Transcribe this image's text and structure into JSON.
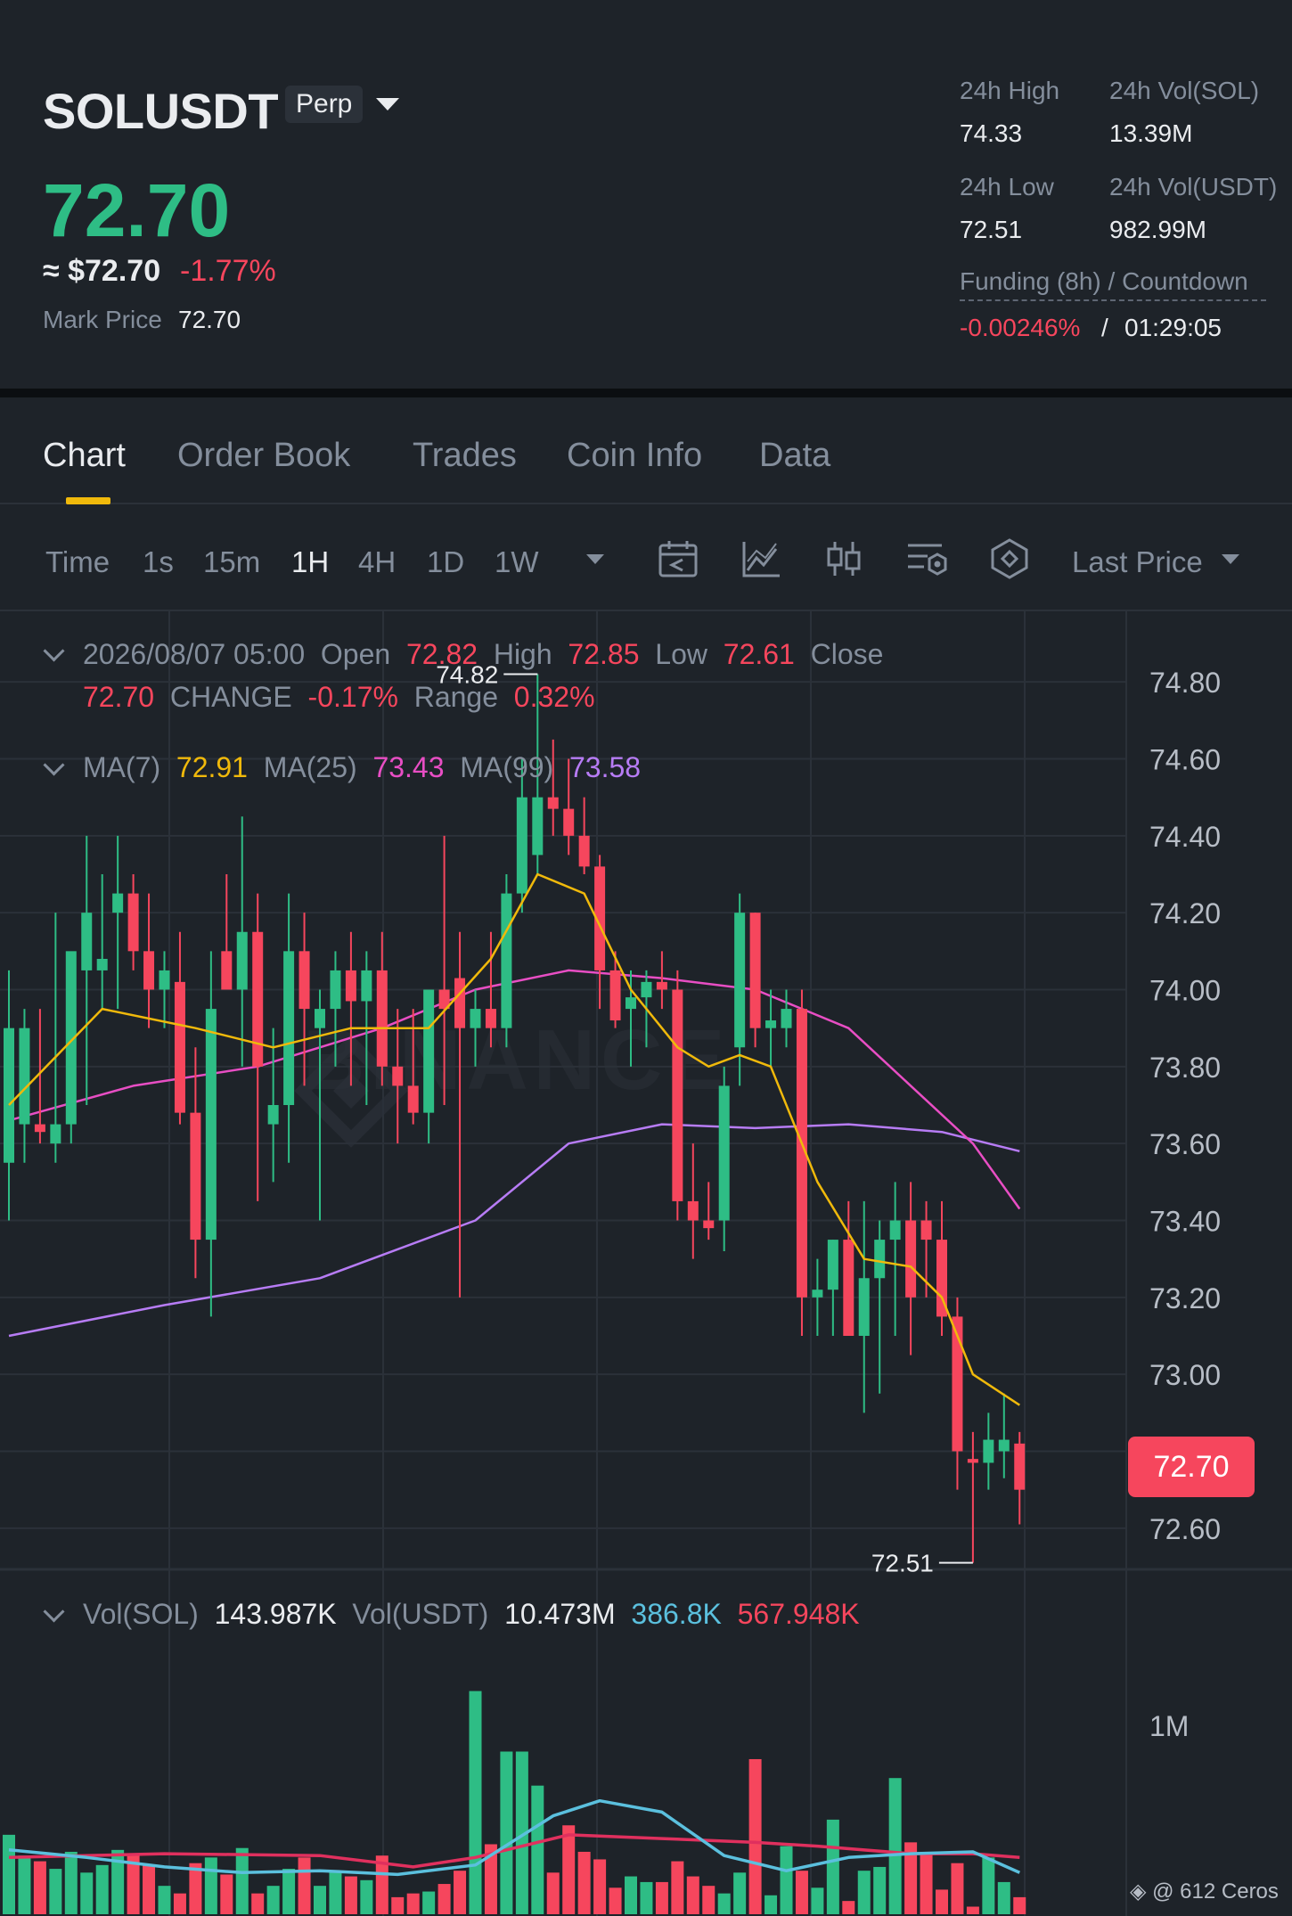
{
  "header": {
    "symbol": "SOLUSDT",
    "contract_type": "Perp",
    "last_price": "72.70",
    "usd_price": "≈ $72.70",
    "change_pct": "-1.77%",
    "mark_price_label": "Mark Price",
    "mark_price": "72.70",
    "stats": {
      "high_label": "24h High",
      "high": "74.33",
      "vol_sol_label": "24h Vol(SOL)",
      "vol_sol": "13.39M",
      "low_label": "24h Low",
      "low": "72.51",
      "vol_usdt_label": "24h Vol(USDT)",
      "vol_usdt": "982.99M"
    },
    "funding_label": "Funding (8h) / Countdown",
    "funding_rate": "-0.00246%",
    "funding_sep": "/",
    "countdown": "01:29:05"
  },
  "tabs": [
    {
      "label": "Chart",
      "active": true
    },
    {
      "label": "Order Book",
      "active": false
    },
    {
      "label": "Trades",
      "active": false
    },
    {
      "label": "Coin Info",
      "active": false
    },
    {
      "label": "Data",
      "active": false
    }
  ],
  "toolbar": {
    "timeframes": [
      {
        "label": "Time",
        "active": false
      },
      {
        "label": "1s",
        "active": false
      },
      {
        "label": "15m",
        "active": false
      },
      {
        "label": "1H",
        "active": true
      },
      {
        "label": "4H",
        "active": false
      },
      {
        "label": "1D",
        "active": false
      },
      {
        "label": "1W",
        "active": false
      }
    ],
    "icons": [
      "calendar-icon",
      "indicator-icon",
      "candle-type-icon",
      "chart-settings-icon",
      "depth-icon"
    ],
    "price_type": "Last Price"
  },
  "ohlc": {
    "datetime": "2026/08/07 05:00",
    "open_label": "Open",
    "open": "72.82",
    "high_label": "High",
    "high": "72.85",
    "low_label": "Low",
    "low": "72.61",
    "close_label": "Close",
    "close": "72.70",
    "change_label": "CHANGE",
    "change": "-0.17%",
    "range_label": "Range",
    "range": "0.32%"
  },
  "ma": {
    "ma7_label": "MA(7)",
    "ma7": "72.91",
    "ma25_label": "MA(25)",
    "ma25": "73.43",
    "ma99_label": "MA(99)",
    "ma99": "73.58"
  },
  "volume": {
    "vol_sol_label": "Vol(SOL)",
    "vol_sol": "143.987K",
    "vol_usdt_label": "Vol(USDT)",
    "vol_usdt": "10.473M",
    "ma5": "386.8K",
    "ma10": "567.948K"
  },
  "price_tag": "72.70",
  "watermark": "BINANCE",
  "footer": "@ 612 Ceros",
  "colors": {
    "up": "#2ebd85",
    "down": "#f6465d",
    "ma7": "#f0b90b",
    "ma25": "#e84ec4",
    "ma99": "#b77cf5",
    "vol_ma5": "#5bc0de",
    "vol_ma10": "#e0305e",
    "accent": "#f0b90b"
  },
  "chart_data": {
    "type": "candlestick",
    "interval": "1H",
    "ylim": [
      72.5,
      74.9
    ],
    "price_ticks": [
      74.8,
      74.6,
      74.4,
      74.2,
      74.0,
      73.8,
      73.6,
      73.4,
      73.2,
      73.0,
      72.8,
      72.6
    ],
    "max_marker": "74.82",
    "min_marker": "72.51",
    "candles": [
      {
        "o": 73.55,
        "h": 74.05,
        "l": 73.4,
        "c": 73.9
      },
      {
        "o": 73.65,
        "h": 73.95,
        "l": 73.55,
        "c": 73.9
      },
      {
        "o": 73.65,
        "h": 73.95,
        "l": 73.6,
        "c": 73.63
      },
      {
        "o": 73.6,
        "h": 74.2,
        "l": 73.55,
        "c": 73.65
      },
      {
        "o": 73.65,
        "h": 74.05,
        "l": 73.6,
        "c": 74.1
      },
      {
        "o": 74.05,
        "h": 74.4,
        "l": 73.7,
        "c": 74.2
      },
      {
        "o": 74.05,
        "h": 74.3,
        "l": 73.95,
        "c": 74.08
      },
      {
        "o": 74.2,
        "h": 74.4,
        "l": 73.95,
        "c": 74.25
      },
      {
        "o": 74.25,
        "h": 74.3,
        "l": 74.05,
        "c": 74.1
      },
      {
        "o": 74.1,
        "h": 74.25,
        "l": 73.9,
        "c": 74.0
      },
      {
        "o": 74.0,
        "h": 74.1,
        "l": 73.9,
        "c": 74.05
      },
      {
        "o": 74.02,
        "h": 74.15,
        "l": 73.65,
        "c": 73.68
      },
      {
        "o": 73.68,
        "h": 73.85,
        "l": 73.25,
        "c": 73.35
      },
      {
        "o": 73.35,
        "h": 74.1,
        "l": 73.15,
        "c": 73.95
      },
      {
        "o": 74.1,
        "h": 74.3,
        "l": 74.0,
        "c": 74.0
      },
      {
        "o": 74.0,
        "h": 74.45,
        "l": 73.8,
        "c": 74.15
      },
      {
        "o": 74.15,
        "h": 74.25,
        "l": 73.45,
        "c": 73.8
      },
      {
        "o": 73.65,
        "h": 73.9,
        "l": 73.5,
        "c": 73.7
      },
      {
        "o": 73.7,
        "h": 74.25,
        "l": 73.55,
        "c": 74.1
      },
      {
        "o": 74.1,
        "h": 74.2,
        "l": 73.75,
        "c": 73.95
      },
      {
        "o": 73.9,
        "h": 74.0,
        "l": 73.4,
        "c": 73.95
      },
      {
        "o": 73.95,
        "h": 74.1,
        "l": 73.8,
        "c": 74.05
      },
      {
        "o": 74.05,
        "h": 74.15,
        "l": 73.75,
        "c": 73.97
      },
      {
        "o": 73.97,
        "h": 74.1,
        "l": 73.7,
        "c": 74.05
      },
      {
        "o": 74.05,
        "h": 74.15,
        "l": 73.75,
        "c": 73.8
      },
      {
        "o": 73.8,
        "h": 73.95,
        "l": 73.6,
        "c": 73.75
      },
      {
        "o": 73.75,
        "h": 73.95,
        "l": 73.65,
        "c": 73.68
      },
      {
        "o": 73.68,
        "h": 74.0,
        "l": 73.6,
        "c": 74.0
      },
      {
        "o": 74.0,
        "h": 74.4,
        "l": 73.7,
        "c": 73.95
      },
      {
        "o": 74.03,
        "h": 74.15,
        "l": 73.2,
        "c": 73.9
      },
      {
        "o": 73.9,
        "h": 74.0,
        "l": 73.8,
        "c": 73.95
      },
      {
        "o": 73.95,
        "h": 74.15,
        "l": 73.85,
        "c": 73.9
      },
      {
        "o": 73.9,
        "h": 74.3,
        "l": 73.85,
        "c": 74.25
      },
      {
        "o": 74.25,
        "h": 74.6,
        "l": 74.2,
        "c": 74.5
      },
      {
        "o": 74.35,
        "h": 74.82,
        "l": 74.3,
        "c": 74.5
      },
      {
        "o": 74.5,
        "h": 74.65,
        "l": 74.4,
        "c": 74.47
      },
      {
        "o": 74.47,
        "h": 74.6,
        "l": 74.35,
        "c": 74.4
      },
      {
        "o": 74.4,
        "h": 74.5,
        "l": 74.3,
        "c": 74.32
      },
      {
        "o": 74.32,
        "h": 74.35,
        "l": 73.95,
        "c": 74.05
      },
      {
        "o": 74.05,
        "h": 74.1,
        "l": 73.9,
        "c": 73.92
      },
      {
        "o": 73.95,
        "h": 74.05,
        "l": 73.8,
        "c": 73.98
      },
      {
        "o": 73.98,
        "h": 74.05,
        "l": 73.85,
        "c": 74.02
      },
      {
        "o": 74.02,
        "h": 74.1,
        "l": 73.95,
        "c": 74.0
      },
      {
        "o": 74.0,
        "h": 74.05,
        "l": 73.4,
        "c": 73.45
      },
      {
        "o": 73.45,
        "h": 73.6,
        "l": 73.3,
        "c": 73.4
      },
      {
        "o": 73.4,
        "h": 73.5,
        "l": 73.35,
        "c": 73.38
      },
      {
        "o": 73.4,
        "h": 73.8,
        "l": 73.32,
        "c": 73.75
      },
      {
        "o": 73.85,
        "h": 74.25,
        "l": 73.75,
        "c": 74.2
      },
      {
        "o": 74.2,
        "h": 74.2,
        "l": 73.85,
        "c": 73.9
      },
      {
        "o": 73.9,
        "h": 74.0,
        "l": 73.8,
        "c": 73.92
      },
      {
        "o": 73.9,
        "h": 74.0,
        "l": 73.85,
        "c": 73.95
      },
      {
        "o": 73.95,
        "h": 74.0,
        "l": 73.1,
        "c": 73.2
      },
      {
        "o": 73.2,
        "h": 73.3,
        "l": 73.1,
        "c": 73.22
      },
      {
        "o": 73.22,
        "h": 73.35,
        "l": 73.1,
        "c": 73.35
      },
      {
        "o": 73.35,
        "h": 73.45,
        "l": 73.1,
        "c": 73.1
      },
      {
        "o": 73.1,
        "h": 73.45,
        "l": 72.9,
        "c": 73.25
      },
      {
        "o": 73.25,
        "h": 73.4,
        "l": 72.95,
        "c": 73.35
      },
      {
        "o": 73.35,
        "h": 73.5,
        "l": 73.1,
        "c": 73.4
      },
      {
        "o": 73.4,
        "h": 73.5,
        "l": 73.05,
        "c": 73.2
      },
      {
        "o": 73.4,
        "h": 73.45,
        "l": 73.2,
        "c": 73.35
      },
      {
        "o": 73.35,
        "h": 73.45,
        "l": 73.1,
        "c": 73.15
      },
      {
        "o": 73.15,
        "h": 73.2,
        "l": 72.7,
        "c": 72.8
      },
      {
        "o": 72.78,
        "h": 72.85,
        "l": 72.51,
        "c": 72.77
      },
      {
        "o": 72.77,
        "h": 72.9,
        "l": 72.7,
        "c": 72.83
      },
      {
        "o": 72.8,
        "h": 72.95,
        "l": 72.73,
        "c": 72.83
      },
      {
        "o": 72.82,
        "h": 72.85,
        "l": 72.61,
        "c": 72.7
      }
    ],
    "ma7_points": [
      [
        0,
        73.7
      ],
      [
        6,
        73.95
      ],
      [
        12,
        73.9
      ],
      [
        17,
        73.85
      ],
      [
        22,
        73.9
      ],
      [
        27,
        73.9
      ],
      [
        31,
        74.08
      ],
      [
        34,
        74.3
      ],
      [
        37,
        74.25
      ],
      [
        40,
        74.0
      ],
      [
        43,
        73.85
      ],
      [
        45,
        73.8
      ],
      [
        47,
        73.83
      ],
      [
        49,
        73.8
      ],
      [
        52,
        73.5
      ],
      [
        55,
        73.3
      ],
      [
        58,
        73.28
      ],
      [
        60,
        73.2
      ],
      [
        62,
        73.0
      ],
      [
        65,
        72.92
      ]
    ],
    "ma25_points": [
      [
        0,
        73.66
      ],
      [
        8,
        73.75
      ],
      [
        16,
        73.8
      ],
      [
        24,
        73.9
      ],
      [
        30,
        74.0
      ],
      [
        36,
        74.05
      ],
      [
        42,
        74.03
      ],
      [
        48,
        74.0
      ],
      [
        54,
        73.9
      ],
      [
        58,
        73.75
      ],
      [
        62,
        73.6
      ],
      [
        65,
        73.43
      ]
    ],
    "ma99_points": [
      [
        0,
        73.1
      ],
      [
        10,
        73.18
      ],
      [
        20,
        73.25
      ],
      [
        30,
        73.4
      ],
      [
        36,
        73.6
      ],
      [
        42,
        73.65
      ],
      [
        48,
        73.64
      ],
      [
        54,
        73.65
      ],
      [
        60,
        73.63
      ],
      [
        65,
        73.58
      ]
    ],
    "volume": {
      "ylim": [
        0,
        1800000
      ],
      "tick": "1M",
      "values": [
        420,
        310,
        280,
        240,
        330,
        220,
        260,
        340,
        320,
        260,
        150,
        110,
        270,
        300,
        210,
        350,
        110,
        150,
        240,
        300,
        150,
        230,
        200,
        180,
        310,
        90,
        110,
        120,
        160,
        230,
        1180,
        370,
        860,
        860,
        680,
        220,
        470,
        330,
        290,
        140,
        200,
        170,
        170,
        280,
        200,
        150,
        110,
        220,
        820,
        100,
        360,
        230,
        140,
        500,
        70,
        230,
        250,
        720,
        380,
        330,
        130,
        270,
        40,
        300,
        170,
        90
      ],
      "ma5": [
        [
          0,
          340
        ],
        [
          5,
          300
        ],
        [
          10,
          250
        ],
        [
          15,
          220
        ],
        [
          20,
          230
        ],
        [
          25,
          210
        ],
        [
          30,
          260
        ],
        [
          35,
          520
        ],
        [
          38,
          600
        ],
        [
          42,
          540
        ],
        [
          46,
          310
        ],
        [
          50,
          230
        ],
        [
          54,
          300
        ],
        [
          58,
          320
        ],
        [
          62,
          330
        ],
        [
          65,
          220
        ]
      ],
      "ma10": [
        [
          0,
          300
        ],
        [
          10,
          320
        ],
        [
          20,
          310
        ],
        [
          26,
          250
        ],
        [
          30,
          300
        ],
        [
          36,
          420
        ],
        [
          42,
          400
        ],
        [
          48,
          380
        ],
        [
          52,
          360
        ],
        [
          58,
          320
        ],
        [
          62,
          320
        ],
        [
          65,
          300
        ]
      ]
    }
  }
}
